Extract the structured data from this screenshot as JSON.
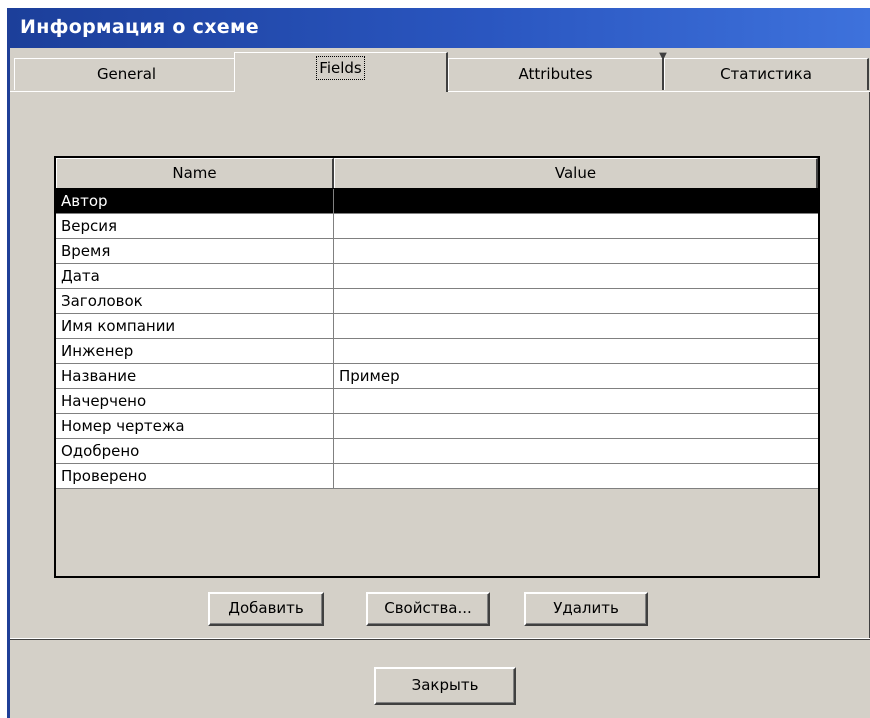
{
  "window": {
    "title": "Информация о схеме"
  },
  "tabs": [
    {
      "label": "General",
      "active": false
    },
    {
      "label": "Fields",
      "active": true
    },
    {
      "label": "Attributes",
      "active": false
    },
    {
      "label": "Статистика",
      "active": false
    }
  ],
  "table": {
    "headers": {
      "name": "Name",
      "value": "Value"
    },
    "rows": [
      {
        "name": "Автор",
        "value": "",
        "selected": true
      },
      {
        "name": "Версия",
        "value": ""
      },
      {
        "name": "Время",
        "value": ""
      },
      {
        "name": "Дата",
        "value": ""
      },
      {
        "name": "Заголовок",
        "value": ""
      },
      {
        "name": "Имя компании",
        "value": ""
      },
      {
        "name": "Инженер",
        "value": ""
      },
      {
        "name": "Название",
        "value": "Пример"
      },
      {
        "name": "Начерчено",
        "value": ""
      },
      {
        "name": "Номер чертежа",
        "value": ""
      },
      {
        "name": "Одобрено",
        "value": ""
      },
      {
        "name": "Проверено",
        "value": ""
      }
    ]
  },
  "buttons": {
    "add": "Добавить",
    "properties": "Свойства...",
    "delete": "Удалить",
    "close": "Закрыть"
  },
  "colors": {
    "titlebar": "#1c3f9a",
    "face": "#d4d0c8",
    "selection": "#000000"
  }
}
